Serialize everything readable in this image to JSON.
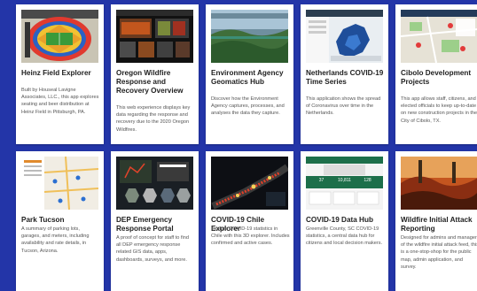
{
  "cards": [
    {
      "title": "Heinz Field Explorer",
      "desc": "Built by Houseal Lavigne Associates, LLC., this app explores seating and beer distribution at Heinz Field in Pittsburgh, PA.",
      "thumb": "stadium-map-thumbnail"
    },
    {
      "title": "Oregon Wildfire Response and Recovery Overview",
      "desc": "This web experience displays key data regarding the response and recovery due to the 2020 Oregon Wildfires.",
      "thumb": "wildfire-dashboard-thumbnail"
    },
    {
      "title": "Environment Agency Geomatics Hub",
      "desc": "Discover how the Environment Agency captures, processes, and analyses the data they capture.",
      "thumb": "landscape-photo-thumbnail"
    },
    {
      "title": "Netherlands COVID-19 Time Series",
      "desc": "This application shows the spread of Coronavirus over time in the Netherlands.",
      "thumb": "netherlands-map-thumbnail"
    },
    {
      "title": "Cibolo Development Projects",
      "desc": "This app allows staff, citizens, and elected officials to keep up-to-date on new construction projects in the City of Cibolo, TX.",
      "thumb": "development-map-thumbnail"
    },
    {
      "title": "Park Tucson",
      "desc": "A summary of parking lots, garages, and meters, including availability and rate details, in Tucson, Arizona.",
      "thumb": "parking-map-thumbnail"
    },
    {
      "title": "DEP Emergency Response Portal",
      "desc": "A proof of concept for staff to find all DEP emergency response related GIS data, apps, dashboards, surveys, and more.",
      "thumb": "portal-hexagon-thumbnail"
    },
    {
      "title": "COVID-19 Chile Explorer",
      "desc": "Explore COVID-19 statistics in Chile with this 3D explorer. Includes confirmed and active cases.",
      "thumb": "chile-3d-map-thumbnail"
    },
    {
      "title": "COVID-19 Data Hub",
      "desc": "Greenville County, SC COVID-19 statistics, a central data hub for citizens and local decision makers.",
      "thumb": "covid-hub-thumbnail"
    },
    {
      "title": "Wildfire Initial Attack Reporting",
      "desc": "Designed for admins and managers of the wildfire initial attack feed, this is a one-stop-shop for the public map, admin application, and survey.",
      "thumb": "wildfire-photo-thumbnail"
    }
  ],
  "hub": {
    "stat_1": "37",
    "stat_2": "10,811",
    "stat_3": "128"
  },
  "colors": {
    "background": "#2335a8",
    "card": "#ffffff",
    "title": "#222222",
    "text": "#555555"
  }
}
